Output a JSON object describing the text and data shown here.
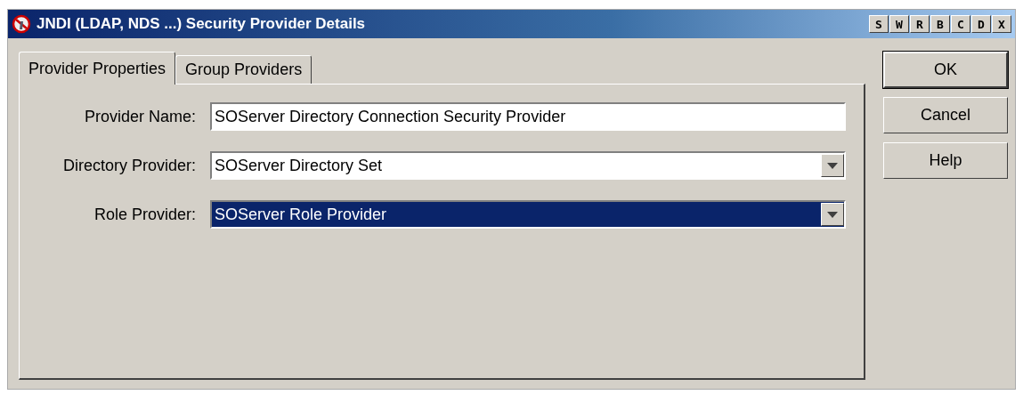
{
  "window": {
    "title": "JNDI (LDAP, NDS ...) Security Provider Details",
    "title_buttons": [
      "S",
      "W",
      "R",
      "B",
      "C",
      "D",
      "X"
    ]
  },
  "tabs": [
    {
      "label": "Provider Properties",
      "selected": true
    },
    {
      "label": "Group Providers",
      "selected": false
    }
  ],
  "fields": [
    {
      "kind": "text",
      "label": "Provider Name:",
      "value": "SOServer Directory Connection Security Provider",
      "selected": false
    },
    {
      "kind": "dropdown",
      "label": "Directory Provider:",
      "value": "SOServer Directory Set",
      "selected": false
    },
    {
      "kind": "dropdown",
      "label": "Role Provider:",
      "value": "SOServer Role Provider",
      "selected": true
    }
  ],
  "buttons": [
    {
      "label": "OK",
      "default": true
    },
    {
      "label": "Cancel",
      "default": false
    },
    {
      "label": "Help",
      "default": false
    }
  ]
}
